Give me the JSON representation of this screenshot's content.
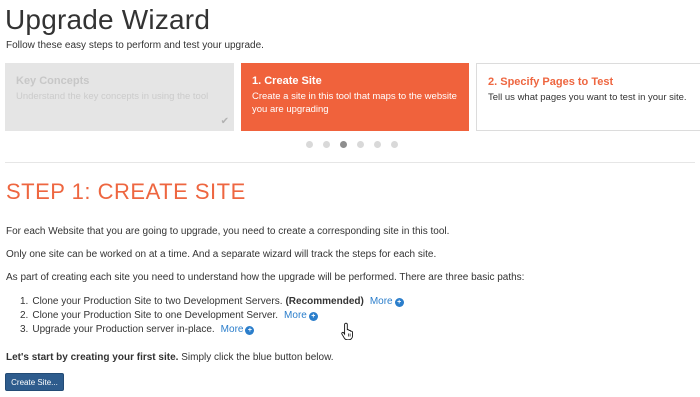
{
  "page": {
    "title": "Upgrade Wizard",
    "subtitle": "Follow these easy steps to perform and test your upgrade."
  },
  "steps": [
    {
      "title": "Key Concepts",
      "description": "Understand the key concepts in using the tool",
      "state": "done"
    },
    {
      "title": "1. Create Site",
      "description": "Create a site in this tool that maps to the website you are upgrading",
      "state": "active"
    },
    {
      "title": "2. Specify Pages to Test",
      "description": "Tell us what pages you want to test in your site.",
      "state": "next"
    }
  ],
  "carousel": {
    "dot_count": 6,
    "active_index": 2
  },
  "step_section": {
    "heading": "STEP 1: CREATE SITE",
    "paragraphs": [
      "For each Website that you are going to upgrade, you need to create a corresponding site in this tool.",
      "Only one site can be worked on at a time. And a separate wizard will track the steps for each site.",
      "As part of creating each site you need to understand how the upgrade will be performed. There are three basic paths:"
    ],
    "paths": [
      {
        "num": "1.",
        "text": "Clone your Production Site to two Development Servers.",
        "badge": "(Recommended)",
        "more": "More"
      },
      {
        "num": "2.",
        "text": "Clone your Production Site to one Development Server.",
        "badge": "",
        "more": "More"
      },
      {
        "num": "3.",
        "text": "Upgrade your Production server in-place.",
        "badge": "",
        "more": "More"
      }
    ],
    "cta_bold": "Let's start by creating your first site.",
    "cta_rest": " Simply click the blue button below.",
    "create_button": "Create Site..."
  },
  "colors": {
    "accent": "#f0623c",
    "link": "#2b7ecb",
    "button": "#2e5c8d"
  },
  "icons": {
    "check": "check-icon",
    "more": "plus-circle-icon",
    "cursor": "hand-pointer-icon"
  }
}
